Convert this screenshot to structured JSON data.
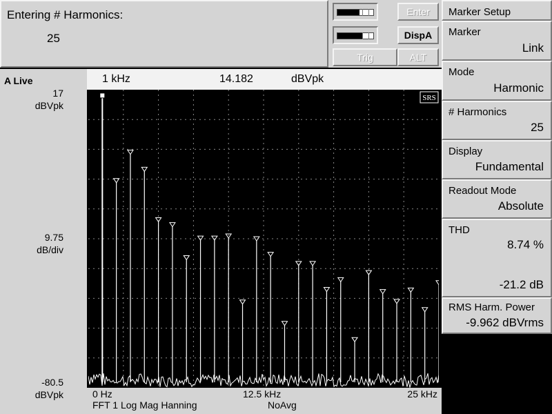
{
  "entry": {
    "title": "Entering # Harmonics:",
    "value": "25"
  },
  "controls": {
    "enter": "Enter",
    "disp": "DispA",
    "trig": "Trig",
    "alt": "ALT",
    "meter1_level": 0.62,
    "meter2_level": 0.7
  },
  "menu": {
    "title": "Marker Setup",
    "marker": {
      "label": "Marker",
      "value": "Link"
    },
    "mode": {
      "label": "Mode",
      "value": "Harmonic"
    },
    "harmonics": {
      "label": "# Harmonics",
      "value": "25"
    },
    "display": {
      "label": "Display",
      "value": "Fundamental"
    },
    "readout": {
      "label": "Readout Mode",
      "value": "Absolute"
    },
    "thd": {
      "label": "THD",
      "percent": "8.74 %",
      "db": "-21.2 dB"
    },
    "rms": {
      "label": "RMS Harm. Power",
      "value": "-9.962 dBVrms"
    }
  },
  "scale": {
    "live": "A Live",
    "top": "17",
    "top_unit": "dBVpk",
    "mid": "9.75",
    "mid_unit": "dB/div",
    "bottom": "-80.5",
    "bottom_unit": "dBVpk"
  },
  "marker_readout": {
    "freq": "1 kHz",
    "value": "14.182",
    "unit": "dBVpk"
  },
  "footer": {
    "x_start": "0 Hz",
    "x_mid": "12.5 kHz",
    "x_end": "25 kHz",
    "measurement": "FFT 1 Log Mag Hanning",
    "avg": "NoAvg"
  },
  "logo": "SRS",
  "colors": {
    "panel": "#d4d4d4",
    "plot_bg": "#000000",
    "trace": "#ffffff"
  },
  "chart_data": {
    "type": "line",
    "x_unit": "kHz",
    "y_unit": "dBVpk",
    "xlim": [
      0,
      25
    ],
    "ylim": [
      -80.5,
      17
    ],
    "grid": true,
    "harmonic_markers": {
      "x": [
        1,
        2,
        3,
        4,
        5,
        6,
        7,
        8,
        9,
        10,
        11,
        12,
        13,
        14,
        15,
        16,
        17,
        18,
        19,
        20,
        21,
        22,
        23,
        24,
        25
      ],
      "y": [
        14.2,
        -13.2,
        -3.9,
        -9.5,
        -26.0,
        -27.6,
        -38.4,
        -32.0,
        -32.0,
        -31.3,
        -52.9,
        -32.2,
        -37.3,
        -59.9,
        -40.3,
        -40.3,
        -48.8,
        -45.6,
        -65.2,
        -43.3,
        -49.5,
        -52.7,
        -49.0,
        -55.4,
        -46.6
      ]
    }
  }
}
